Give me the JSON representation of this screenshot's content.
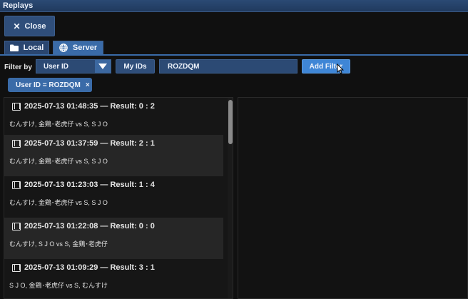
{
  "window": {
    "title": "Replays"
  },
  "toolbar": {
    "close_label": "Close"
  },
  "tabs": [
    {
      "label": "Local",
      "icon": "folder-icon",
      "selected": false
    },
    {
      "label": "Server",
      "icon": "globe-icon",
      "selected": true
    }
  ],
  "filter": {
    "label": "Filter by",
    "field_selected": "User ID",
    "myids_label": "My IDs",
    "value": "ROZDQM",
    "add_label": "Add Filter"
  },
  "active_filters": [
    {
      "label": "User ID = ROZDQM",
      "remove": "×"
    }
  ],
  "replays": [
    {
      "title": "2025-07-13 01:48:35 — Result: 0 : 2",
      "players": "むんすけ, 金鶏･老虎仔 vs S, S J O"
    },
    {
      "title": "2025-07-13 01:37:59 — Result: 2 : 1",
      "players": "むんすけ, 金鶏･老虎仔 vs S, S J O"
    },
    {
      "title": "2025-07-13 01:23:03 — Result: 1 : 4",
      "players": "むんすけ, 金鶏･老虎仔 vs S, S J O"
    },
    {
      "title": "2025-07-13 01:22:08 — Result: 0 : 0",
      "players": "むんすけ, S J O vs S, 金鶏･老虎仔"
    },
    {
      "title": "2025-07-13 01:09:29 — Result: 3 : 1",
      "players": "S J O, 金鶏･老虎仔 vs S, むんすけ"
    }
  ],
  "colors": {
    "accent": "#3a6ba8",
    "button": "#2f4e7a",
    "add_button": "#3f86d6",
    "background": "#101010"
  }
}
